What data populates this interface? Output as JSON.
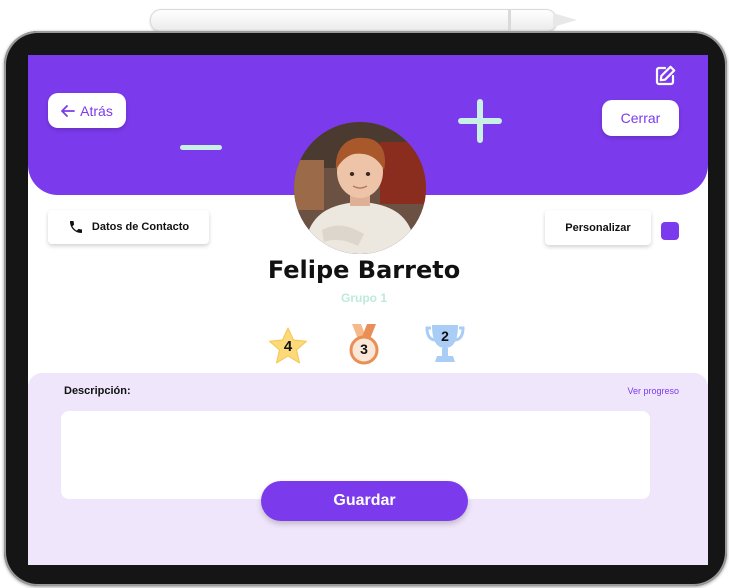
{
  "header": {
    "back_label": "Atrás",
    "close_label": "Cerrar"
  },
  "contact": {
    "label": "Datos de Contacto"
  },
  "customize": {
    "label": "Personalizar",
    "swatch_color": "#7c3aed"
  },
  "profile": {
    "name": "Felipe Barreto",
    "group": "Grupo 1"
  },
  "awards": [
    {
      "icon": "star-icon",
      "count": "4"
    },
    {
      "icon": "medal-icon",
      "count": "3"
    },
    {
      "icon": "trophy-icon",
      "count": "2"
    }
  ],
  "description": {
    "label": "Descripción:",
    "progress_link": "Ver progreso",
    "value": ""
  },
  "save_label": "Guardar",
  "colors": {
    "accent": "#7c3aed",
    "mint": "#c9f0e6",
    "panel": "#f0e6fb"
  }
}
